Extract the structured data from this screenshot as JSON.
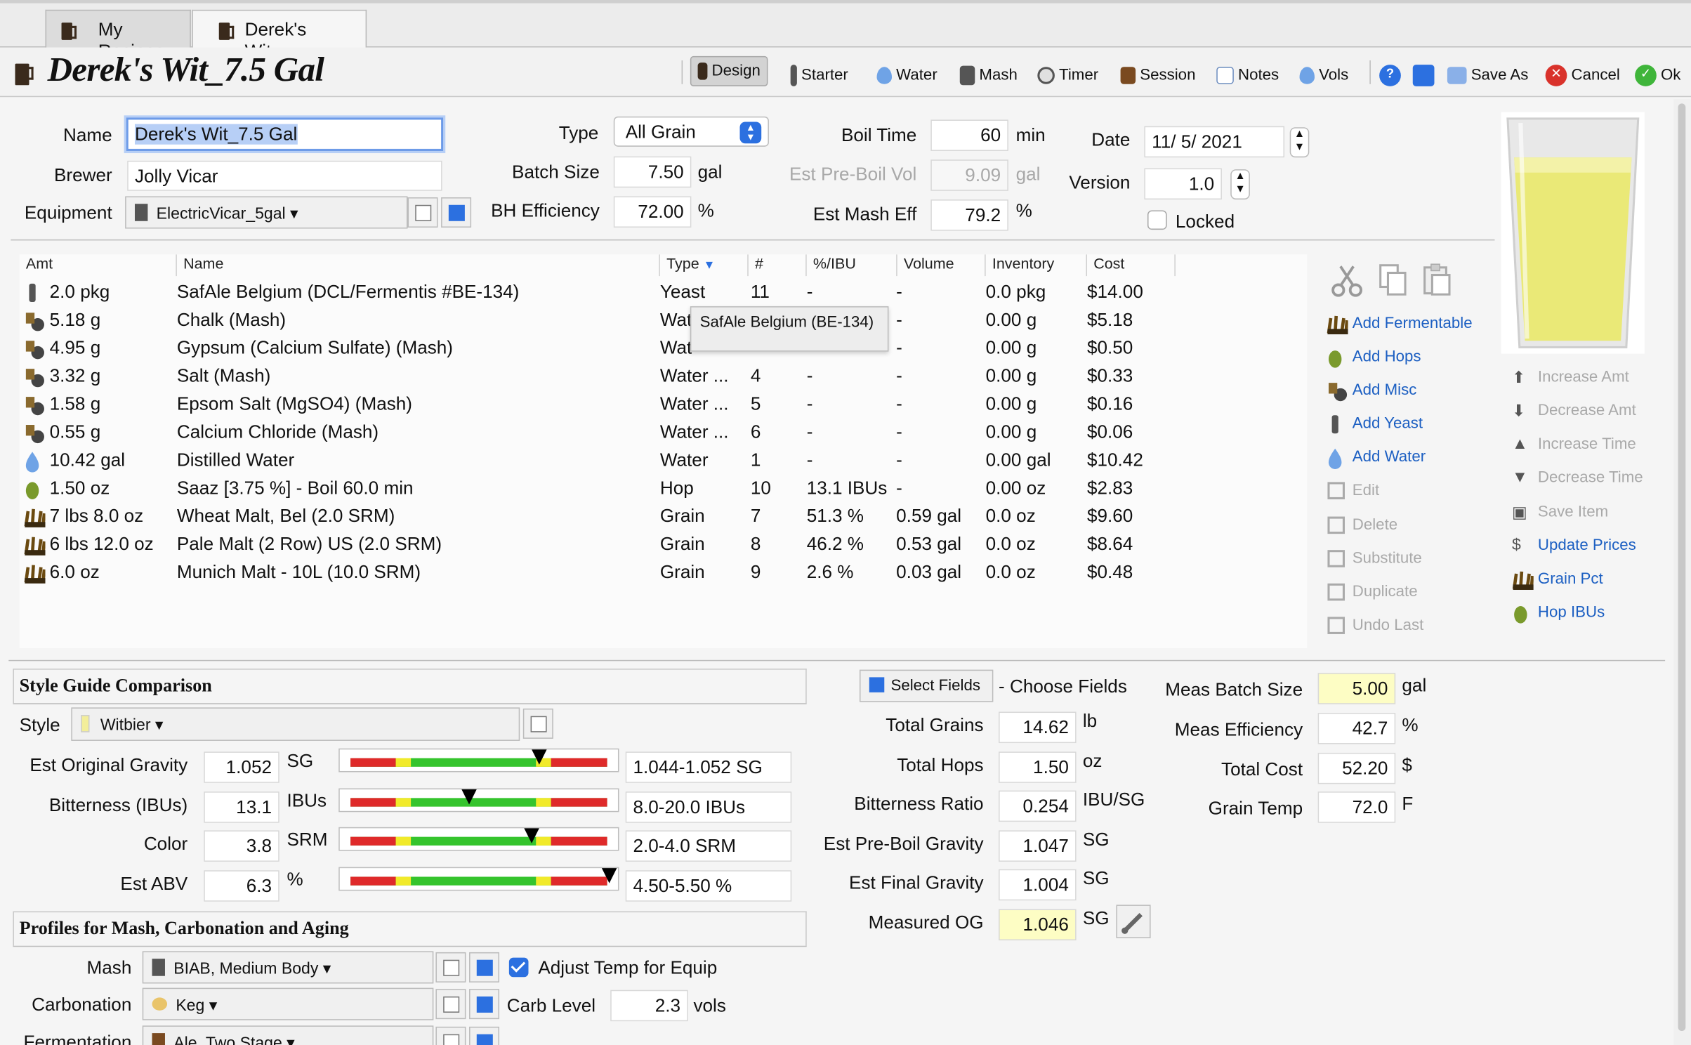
{
  "tabs": [
    {
      "label": "My Recipes"
    },
    {
      "label": "Derek's Wit_..."
    }
  ],
  "header": {
    "title": "Derek's Wit_7.5 Gal"
  },
  "toolbar": {
    "design": "Design",
    "starter": "Starter",
    "water": "Water",
    "mash": "Mash",
    "timer": "Timer",
    "session": "Session",
    "notes": "Notes",
    "vols": "Vols",
    "save_as": "Save As",
    "cancel": "Cancel",
    "ok": "Ok"
  },
  "form": {
    "name_label": "Name",
    "name": "Derek's Wit_7.5 Gal",
    "brewer_label": "Brewer",
    "brewer": "Jolly Vicar",
    "equipment_label": "Equipment",
    "equipment": "ElectricVicar_5gal",
    "type_label": "Type",
    "type": "All Grain",
    "batch_label": "Batch Size",
    "batch": "7.50",
    "batch_unit": "gal",
    "bh_label": "BH Efficiency",
    "bh": "72.00",
    "bh_unit": "%",
    "boil_label": "Boil Time",
    "boil": "60",
    "boil_unit": "min",
    "preboil_label": "Est Pre-Boil Vol",
    "preboil": "9.09",
    "preboil_unit": "gal",
    "mash_eff_label": "Est Mash Eff",
    "mash_eff": "79.2",
    "mash_eff_unit": "%",
    "date_label": "Date",
    "date": "11/ 5/ 2021",
    "version_label": "Version",
    "version": "1.0",
    "locked_label": "Locked"
  },
  "ingredients": {
    "columns": [
      "Amt",
      "Name",
      "Type",
      "#",
      "%/IBU",
      "Volume",
      "Inventory",
      "Cost"
    ],
    "rows": [
      {
        "icon": "yeast-icon",
        "amt": "2.0 pkg",
        "name": "SafAle Belgium (DCL/Fermentis #BE-134)",
        "type": "Yeast",
        "num": "11",
        "pct": "-",
        "vol": "-",
        "inv": "0.0 pkg",
        "cost": "$14.00"
      },
      {
        "icon": "misc-icon",
        "amt": "5.18 g",
        "name": "Chalk (Mash)",
        "type": "Wat",
        "num": "",
        "pct": "",
        "vol": "-",
        "inv": "0.00 g",
        "cost": "$5.18"
      },
      {
        "icon": "misc-icon",
        "amt": "4.95 g",
        "name": "Gypsum (Calcium Sulfate) (Mash)",
        "type": "Wat",
        "num": "",
        "pct": "",
        "vol": "-",
        "inv": "0.00 g",
        "cost": "$0.50"
      },
      {
        "icon": "misc-icon",
        "amt": "3.32 g",
        "name": "Salt (Mash)",
        "type": "Water ...",
        "num": "4",
        "pct": "-",
        "vol": "-",
        "inv": "0.00 g",
        "cost": "$0.33"
      },
      {
        "icon": "misc-icon",
        "amt": "1.58 g",
        "name": "Epsom Salt (MgSO4) (Mash)",
        "type": "Water ...",
        "num": "5",
        "pct": "-",
        "vol": "-",
        "inv": "0.00 g",
        "cost": "$0.16"
      },
      {
        "icon": "misc-icon",
        "amt": "0.55 g",
        "name": "Calcium Chloride (Mash)",
        "type": "Water ...",
        "num": "6",
        "pct": "-",
        "vol": "-",
        "inv": "0.00 g",
        "cost": "$0.06"
      },
      {
        "icon": "water-drop-icon",
        "amt": "10.42 gal",
        "name": "Distilled Water",
        "type": "Water",
        "num": "1",
        "pct": "-",
        "vol": "-",
        "inv": "0.00 gal",
        "cost": "$10.42"
      },
      {
        "icon": "hop-icon",
        "amt": "1.50 oz",
        "name": "Saaz [3.75 %] - Boil 60.0 min",
        "type": "Hop",
        "num": "10",
        "pct": "13.1 IBUs",
        "vol": "-",
        "inv": "0.00 oz",
        "cost": "$2.83"
      },
      {
        "icon": "grain-icon",
        "amt": "7 lbs 8.0 oz",
        "name": "Wheat Malt, Bel (2.0 SRM)",
        "type": "Grain",
        "num": "7",
        "pct": "51.3 %",
        "vol": "0.59 gal",
        "inv": "0.0 oz",
        "cost": "$9.60"
      },
      {
        "icon": "grain-icon",
        "amt": "6 lbs 12.0 oz",
        "name": "Pale Malt (2 Row) US (2.0 SRM)",
        "type": "Grain",
        "num": "8",
        "pct": "46.2 %",
        "vol": "0.53 gal",
        "inv": "0.0 oz",
        "cost": "$8.64"
      },
      {
        "icon": "grain-icon",
        "amt": "6.0 oz",
        "name": "Munich Malt - 10L (10.0 SRM)",
        "type": "Grain",
        "num": "9",
        "pct": "2.6 %",
        "vol": "0.03 gal",
        "inv": "0.0 oz",
        "cost": "$0.48"
      }
    ],
    "tooltip": "SafAle Belgium (BE-134)"
  },
  "actions": {
    "add_fermentable": "Add Fermentable",
    "add_hops": "Add Hops",
    "add_misc": "Add Misc",
    "add_yeast": "Add Yeast",
    "add_water": "Add Water",
    "edit": "Edit",
    "delete": "Delete",
    "substitute": "Substitute",
    "duplicate": "Duplicate",
    "undo_last": "Undo Last"
  },
  "actions2": {
    "increase_amt": "Increase Amt",
    "decrease_amt": "Decrease Amt",
    "increase_time": "Increase Time",
    "decrease_time": "Decrease Time",
    "save_item": "Save Item",
    "update_prices": "Update Prices",
    "grain_pct": "Grain Pct",
    "hop_ibus": "Hop IBUs"
  },
  "style": {
    "section": "Style Guide Comparison",
    "style_label": "Style",
    "style": "Witbier",
    "rows": [
      {
        "label": "Est Original Gravity",
        "value": "1.052",
        "unit": "SG",
        "range": "1.044-1.052 SG",
        "marker": 0.73
      },
      {
        "label": "Bitterness (IBUs)",
        "value": "13.1",
        "unit": "IBUs",
        "range": "8.0-20.0 IBUs",
        "marker": 0.46
      },
      {
        "label": "Color",
        "value": "3.8",
        "unit": "SRM",
        "range": "2.0-4.0 SRM",
        "marker": 0.7
      },
      {
        "label": "Est ABV",
        "value": "6.3",
        "unit": "%",
        "range": "4.50-5.50 %",
        "marker": 1.0
      }
    ]
  },
  "stats": {
    "select_fields": "Select Fields",
    "choose_fields": "- Choose Fields",
    "rows": [
      {
        "label": "Total Grains",
        "value": "14.62",
        "unit": "lb"
      },
      {
        "label": "Total Hops",
        "value": "1.50",
        "unit": "oz"
      },
      {
        "label": "Bitterness Ratio",
        "value": "0.254",
        "unit": "IBU/SG"
      },
      {
        "label": "Est Pre-Boil Gravity",
        "value": "1.047",
        "unit": "SG"
      },
      {
        "label": "Est Final Gravity",
        "value": "1.004",
        "unit": "SG"
      },
      {
        "label": "Measured OG",
        "value": "1.046",
        "unit": "SG"
      }
    ],
    "right": [
      {
        "label": "Meas Batch Size",
        "value": "5.00",
        "unit": "gal"
      },
      {
        "label": "Meas Efficiency",
        "value": "42.7",
        "unit": "%"
      },
      {
        "label": "Total Cost",
        "value": "52.20",
        "unit": "$"
      },
      {
        "label": "Grain Temp",
        "value": "72.0",
        "unit": "F"
      }
    ]
  },
  "profiles": {
    "section": "Profiles for Mash, Carbonation and Aging",
    "mash_label": "Mash",
    "mash": "BIAB, Medium Body",
    "adjust_label": "Adjust Temp for Equip",
    "carb_label": "Carbonation",
    "carb": "Keg",
    "carb_level_label": "Carb Level",
    "carb_level": "2.3",
    "carb_level_unit": "vols",
    "ferm_label": "Fermentation",
    "ferm": "Ale, Two Stage"
  },
  "colors": {
    "accent": "#2c70e0",
    "beer": "#eae977",
    "link": "#1c5fc2"
  }
}
